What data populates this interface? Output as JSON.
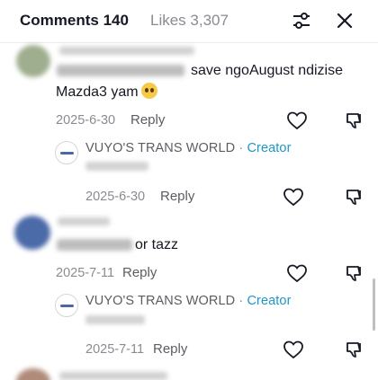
{
  "header": {
    "comments_label": "Comments 140",
    "likes_label": "Likes 3,307",
    "filter_icon": "filter-sliders-icon",
    "close_icon": "close-icon"
  },
  "comments": [
    {
      "text_line1": "save ngoAugust ndizise",
      "text_line2": "Mazda3 yam",
      "emoji": "pleading-face-emoji",
      "date": "2025-6-30",
      "reply_label": "Reply",
      "creator_reply": {
        "name": "VUYO'S TRANS WORLD",
        "separator": "·",
        "badge": "Creator",
        "date": "2025-6-30",
        "reply_label": "Reply"
      }
    },
    {
      "text_line1": "or tazz",
      "date": "2025-7-11",
      "reply_label": "Reply",
      "creator_reply": {
        "name": "VUYO'S TRANS WORLD",
        "separator": "·",
        "badge": "Creator",
        "date": "2025-7-11",
        "reply_label": "Reply"
      }
    }
  ],
  "colors": {
    "text": "#161823",
    "muted": "#8a8b91",
    "creator_badge": "#1b98c8"
  }
}
